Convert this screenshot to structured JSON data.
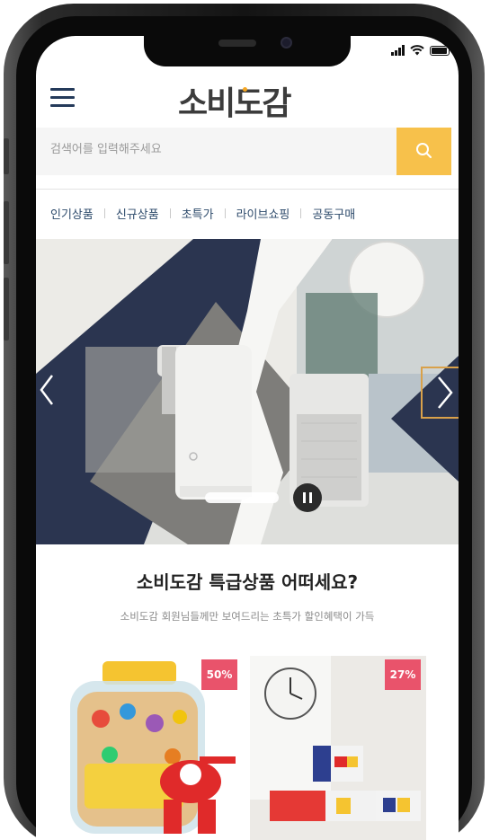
{
  "app": {
    "logo_text": "소비도감"
  },
  "search": {
    "placeholder": "검색어를 입력해주세요"
  },
  "nav": {
    "items": [
      "인기상품",
      "신규상품",
      "초특가",
      "라이브쇼핑",
      "공동구매"
    ]
  },
  "section": {
    "title": "소비도감 특급상품 어떠세요?",
    "subtitle": "소비도감 회원님들께만 보여드리는 초특가 할인혜택이 가득"
  },
  "products": [
    {
      "badge": "50%"
    },
    {
      "badge": "27%"
    }
  ],
  "colors": {
    "accent": "#f7c14b",
    "navy": "#2b3550",
    "nav_text": "#2d4a6b",
    "badge": "#e9536b"
  },
  "icons": [
    "menu-icon",
    "search-icon",
    "chevron-left-icon",
    "chevron-right-icon",
    "pause-icon",
    "signal-icon",
    "wifi-icon",
    "battery-icon"
  ]
}
